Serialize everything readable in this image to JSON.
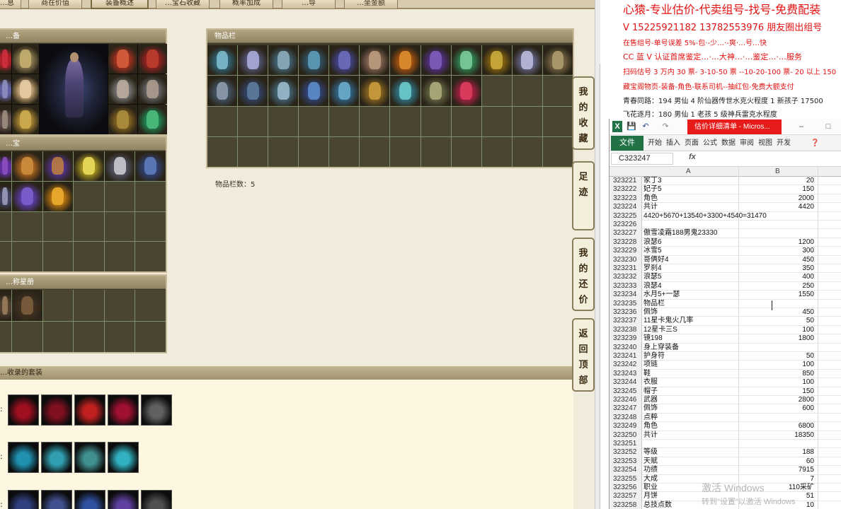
{
  "nav": {
    "tabs": [
      "…息",
      "商在价值",
      "装备概述",
      "…宝石收藏",
      "概率加成",
      "…导",
      "…坐金额"
    ]
  },
  "equip_panel": {
    "title": "…备"
  },
  "treasure_panel": {
    "title": "…宝"
  },
  "star_panel": {
    "title": "…称星册"
  },
  "inventory": {
    "title": "物品栏",
    "count_label": "物品栏数：5"
  },
  "suits": {
    "title": "…收录的套装",
    "prefix": ":"
  },
  "side_buttons": {
    "favorites": "我的收藏",
    "footprints": "足迹",
    "my_offers": "我的还价",
    "back_top": "返回顶部"
  },
  "ad": {
    "line1": "心猿-专业估价-代卖组号-找号-免费配装",
    "line2": "V 15225921182   13782553976 朋友圈出组号",
    "line3": "在售组号-单号误差 5%-包·-少…·-爽·…号…快",
    "line4": "CC 蓝 V 认证首席鉴定…·…大神…·…鉴定…·…服务",
    "line5": "扫码估号 3 万内 30 票- 3-10-50 票  --10-20-100 票- 20 以上 150",
    "line6": "藏宝阁物页-装备-角色-联系司机--抽红包-免费大额支付",
    "line7": "青春同路：194 男仙 4 阶仙器传世水克火程度 1 新孩子 17500",
    "line8": "飞花逐月：180 男仙 1 老孩 5 级神兵雷克水程度"
  },
  "excel": {
    "title_bar": "估价详细清单 - Micros...",
    "ribbon_file": "文件",
    "ribbon_tabs": [
      "开始",
      "插入",
      "页面",
      "公式",
      "数据",
      "审阅",
      "视图",
      "开发"
    ],
    "name_box": "C323247",
    "fx": "fx",
    "col_a": "A",
    "col_b": "B",
    "watermark1": "激活 Windows",
    "watermark2": "转到\"设置\"以激活 Windows",
    "rows": [
      {
        "n": "323221",
        "a": "家丁3",
        "b": "20"
      },
      {
        "n": "323222",
        "a": "妃子5",
        "b": "150"
      },
      {
        "n": "323223",
        "a": "角色",
        "b": "2000"
      },
      {
        "n": "323224",
        "a": "共计",
        "b": "4420"
      },
      {
        "n": "323225",
        "a": "4420+5670+13540+3300+4540=31470",
        "b": ""
      },
      {
        "n": "323226",
        "a": "",
        "b": ""
      },
      {
        "n": "323227",
        "a": "傲雪凌霜188男鬼23330",
        "b": ""
      },
      {
        "n": "323228",
        "a": "浪瑟6",
        "b": "1200"
      },
      {
        "n": "323229",
        "a": "冰雪5",
        "b": "300"
      },
      {
        "n": "323230",
        "a": "哥俩好4",
        "b": "450"
      },
      {
        "n": "323231",
        "a": "罗刹4",
        "b": "350"
      },
      {
        "n": "323232",
        "a": "浪瑟5",
        "b": "400"
      },
      {
        "n": "323233",
        "a": "浪瑟4",
        "b": "250"
      },
      {
        "n": "323234",
        "a": "水月5+一瑟",
        "b": "1550"
      },
      {
        "n": "323235",
        "a": "物品栏",
        "b": ""
      },
      {
        "n": "323236",
        "a": "佩饰",
        "b": "450"
      },
      {
        "n": "323237",
        "a": "11星卡鬼火几率",
        "b": "50"
      },
      {
        "n": "323238",
        "a": "12星卡三S",
        "b": "100"
      },
      {
        "n": "323239",
        "a": "镜198",
        "b": "1800"
      },
      {
        "n": "323240",
        "a": "身上穿装备",
        "b": ""
      },
      {
        "n": "323241",
        "a": "护身符",
        "b": "50"
      },
      {
        "n": "323242",
        "a": "项链",
        "b": "100"
      },
      {
        "n": "323243",
        "a": "鞋",
        "b": "850"
      },
      {
        "n": "323244",
        "a": "衣服",
        "b": "100"
      },
      {
        "n": "323245",
        "a": "帽子",
        "b": "150"
      },
      {
        "n": "323246",
        "a": "武器",
        "b": "2800"
      },
      {
        "n": "323247",
        "a": "佩饰",
        "b": "600"
      },
      {
        "n": "323248",
        "a": "点粹",
        "b": ""
      },
      {
        "n": "323249",
        "a": "角色",
        "b": "6800"
      },
      {
        "n": "323250",
        "a": "共计",
        "b": "18350"
      },
      {
        "n": "323251",
        "a": "",
        "b": ""
      },
      {
        "n": "323252",
        "a": "等级",
        "b": "188"
      },
      {
        "n": "323253",
        "a": "天赋",
        "b": "60"
      },
      {
        "n": "323254",
        "a": "功绩",
        "b": "7915"
      },
      {
        "n": "323255",
        "a": "大成",
        "b": "7"
      },
      {
        "n": "323256",
        "a": "职业",
        "b": "110采矿"
      },
      {
        "n": "323257",
        "a": "月饼",
        "b": "51"
      },
      {
        "n": "323258",
        "a": "总技点数",
        "b": "10"
      }
    ]
  },
  "colors": {
    "ad_red": "#e31212",
    "excel_green": "#217346",
    "panel_bg": "#3e3a2e",
    "page_bg": "#f1ebdc"
  }
}
